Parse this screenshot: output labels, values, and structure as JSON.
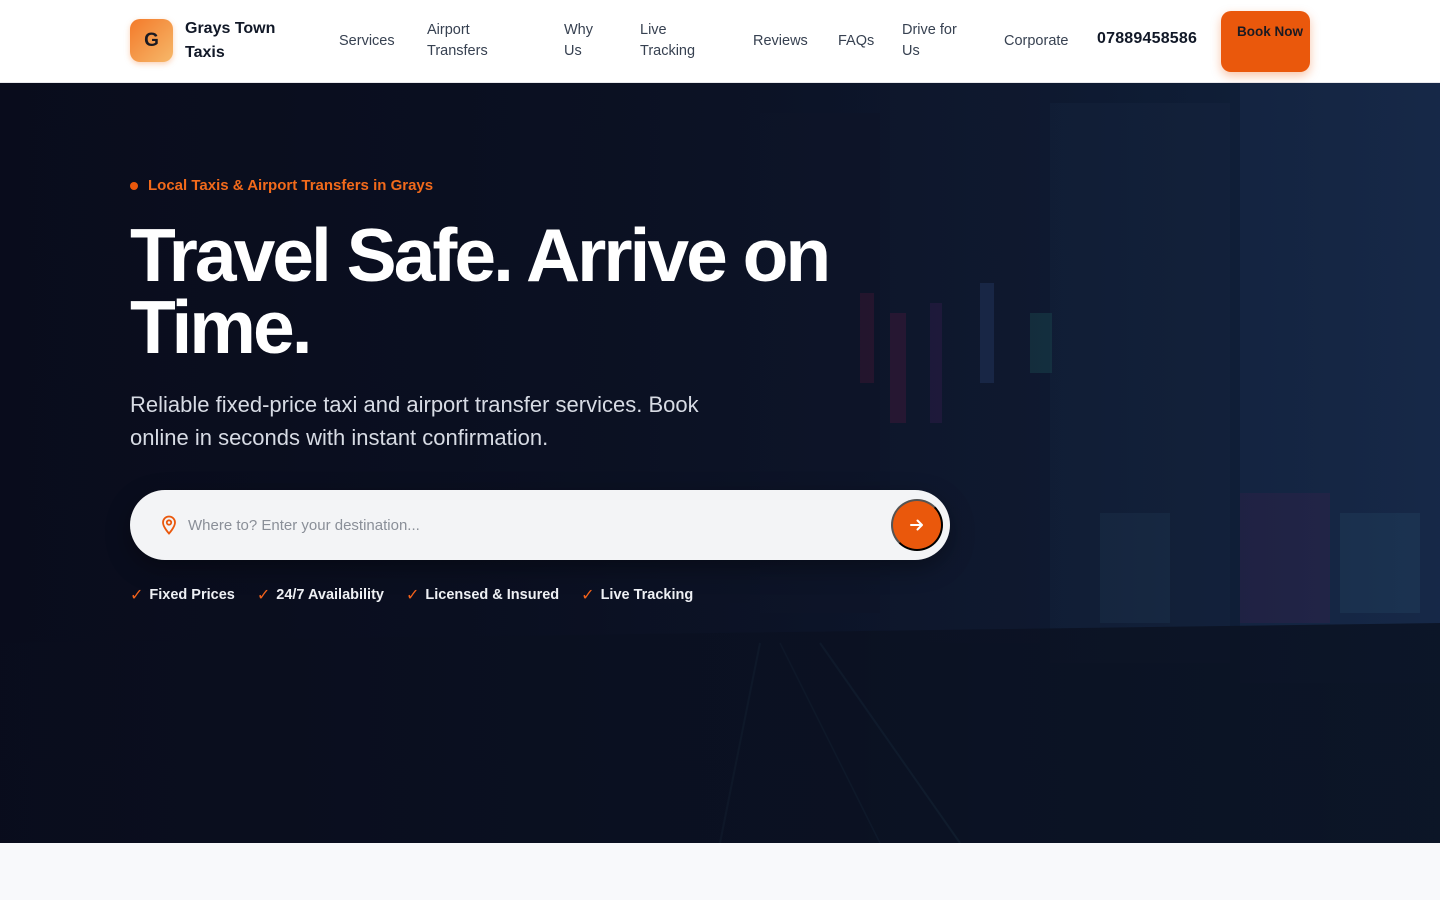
{
  "brand": {
    "initial": "G",
    "name": "Grays Town Taxis"
  },
  "nav": [
    {
      "label": "Services"
    },
    {
      "label": "Airport Transfers"
    },
    {
      "label": "Why Us"
    },
    {
      "label": "Live Tracking"
    },
    {
      "label": "Reviews"
    },
    {
      "label": "FAQs"
    },
    {
      "label": "Drive for Us"
    },
    {
      "label": "Corporate"
    }
  ],
  "header": {
    "phone": "07889458586",
    "book_label": "Book Now"
  },
  "hero": {
    "eyebrow": "Local Taxis & Airport Transfers in Grays",
    "headline": "Travel Safe. Arrive on Time.",
    "subtext": "Reliable fixed-price taxi and airport transfer services. Book online in seconds with instant confirmation.",
    "search": {
      "placeholder": "Where to? Enter your destination...",
      "value": ""
    },
    "features": [
      "Fixed Prices",
      "24/7 Availability",
      "Licensed & Insured",
      "Live Tracking"
    ]
  },
  "icons": {
    "pin": "map-pin-icon",
    "submit": "arrow-right-icon",
    "check": "check-icon"
  },
  "colors": {
    "accent": "#ea580c",
    "hero_bg": "#0b1120",
    "header_bg": "#ffffff"
  }
}
